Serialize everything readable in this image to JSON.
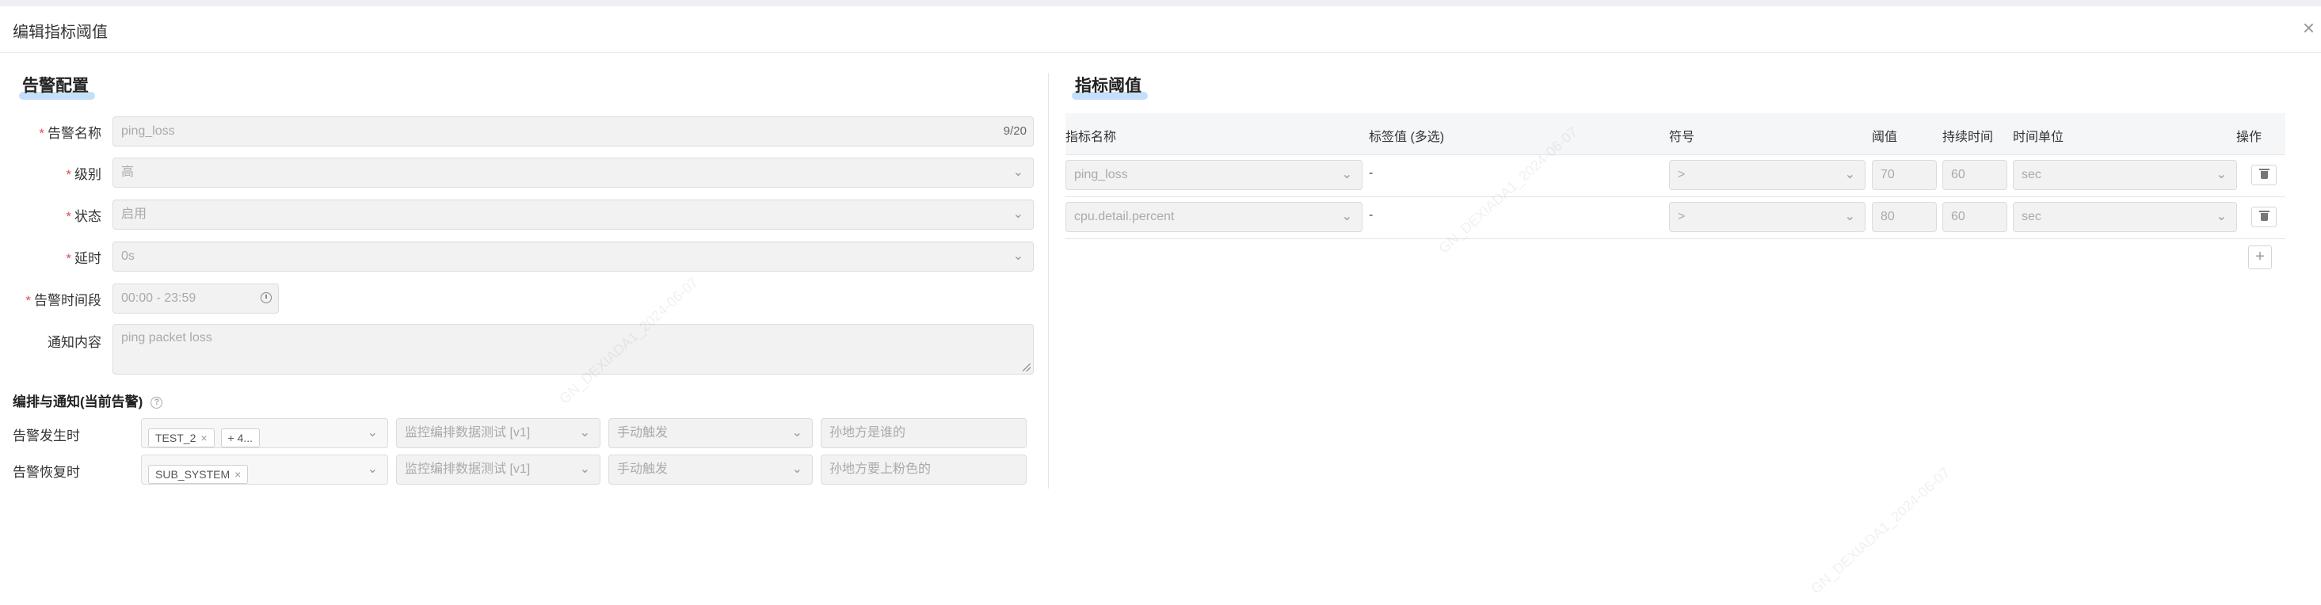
{
  "dialog": {
    "title": "编辑指标阈值",
    "close": "×"
  },
  "alert_config": {
    "section_title": "告警配置",
    "fields": {
      "name": {
        "label": "告警名称",
        "value": "ping_loss",
        "counter": "9/20"
      },
      "level": {
        "label": "级别",
        "value": "高"
      },
      "status": {
        "label": "状态",
        "value": "启用"
      },
      "delay": {
        "label": "延时",
        "value": "0s"
      },
      "period": {
        "label": "告警时间段",
        "value": "00:00 - 23:59"
      },
      "content": {
        "label": "通知内容",
        "value": "ping packet loss"
      }
    }
  },
  "orchestration": {
    "title": "编排与通知(当前告警)",
    "help": "?",
    "rows": [
      {
        "label": "告警发生时",
        "tags": [
          {
            "text": "TEST_2",
            "x": "×"
          },
          {
            "text": "+ 4..."
          }
        ],
        "flow": "监控编排数据测试 [v1]",
        "trigger": "手动触发",
        "note": "孙地方是谁的"
      },
      {
        "label": "告警恢复时",
        "tags": [
          {
            "text": "SUB_SYSTEM",
            "x": "×"
          }
        ],
        "flow": "监控编排数据测试 [v1]",
        "trigger": "手动触发",
        "note": "孙地方要上粉色的"
      }
    ]
  },
  "thresholds": {
    "section_title": "指标阈值",
    "columns": {
      "metric": "指标名称",
      "tag": "标签值 (多选)",
      "symbol": "符号",
      "threshold": "阈值",
      "duration": "持续时间",
      "unit": "时间单位",
      "action": "操作"
    },
    "rows": [
      {
        "metric": "ping_loss",
        "tag": "-",
        "symbol": ">",
        "threshold": "70",
        "duration": "60",
        "unit": "sec"
      },
      {
        "metric": "cpu.detail.percent",
        "tag": "-",
        "symbol": ">",
        "threshold": "80",
        "duration": "60",
        "unit": "sec"
      }
    ],
    "add": "+"
  },
  "watermark": "GN_DEXIADA1_2024-06-07",
  "icons": {
    "chevron": "chevron-down-icon",
    "clock": "clock-icon",
    "delete": "trash-icon",
    "help": "question-icon"
  }
}
